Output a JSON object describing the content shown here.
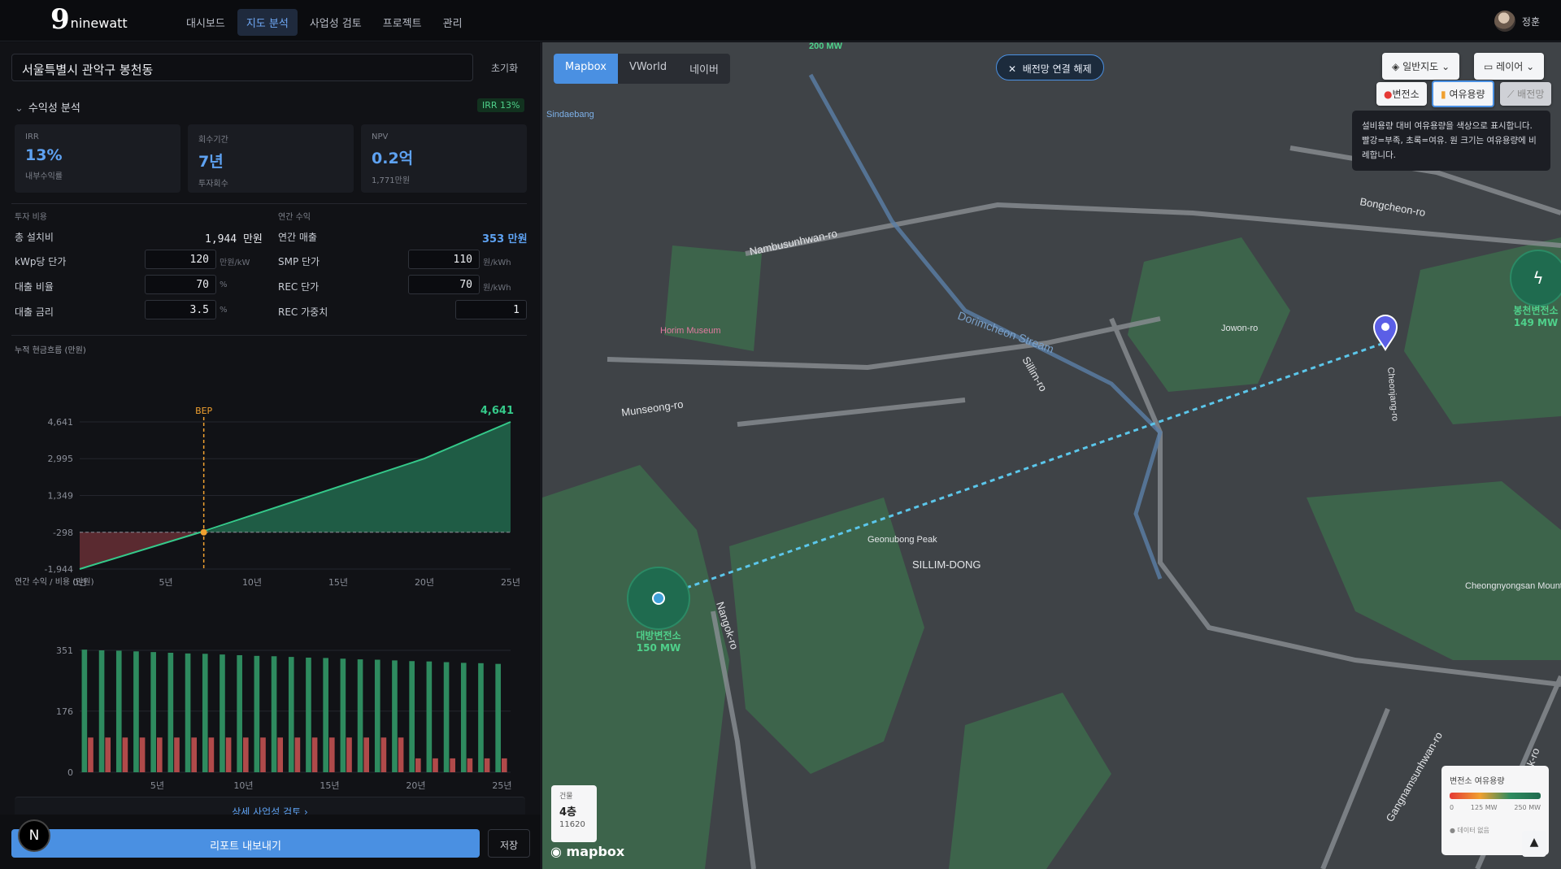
{
  "app": {
    "logo_mark": "9",
    "logo_text": "ninewatt",
    "user_name": "정훈"
  },
  "nav": {
    "items": [
      "대시보드",
      "지도 분석",
      "사업성 검토",
      "프로젝트",
      "관리"
    ],
    "active": "지도 분석"
  },
  "sidebar": {
    "address": "서울특별시 관악구 봉천동",
    "reset_label": "초기화",
    "section_title": "수익성 분석",
    "irr_badge": "IRR 13%",
    "cards": [
      {
        "label": "IRR",
        "value": "13%",
        "sub": "내부수익률"
      },
      {
        "label": "회수기간",
        "value": "7년",
        "sub": "투자회수"
      },
      {
        "label": "NPV",
        "value": "0.2억",
        "sub": "1,771만원"
      }
    ],
    "invest": {
      "title": "투자 비용",
      "total_label": "총 설치비",
      "total_value": "1,944 만원",
      "kw_label": "kWp당 단가",
      "kw_value": "120",
      "kw_unit": "만원/kW",
      "loan_ratio_label": "대출 비율",
      "loan_ratio_value": "70",
      "loan_ratio_unit": "%",
      "rate_label": "대출 금리",
      "rate_value": "3.5",
      "rate_unit": "%"
    },
    "revenue": {
      "title": "연간 수익",
      "sales_label": "연간 매출",
      "sales_value": "353 만원",
      "smp_label": "SMP 단가",
      "smp_value": "110",
      "smp_unit": "원/kWh",
      "rec_label": "REC 단가",
      "rec_value": "70",
      "rec_unit": "원/kWh",
      "weight_label": "REC 가중치",
      "weight_value": "1"
    },
    "cum_chart_title": "누적 현금흐름 (만원)",
    "annual_chart_title": "연간 수익 / 비용 (만원)",
    "detail_button": "상세 사업성 검토 ›",
    "export_button": "리포트 내보내기",
    "save_button": "저장",
    "n_button": "N"
  },
  "chart_data": [
    {
      "type": "area",
      "title": "누적 현금흐름 (만원)",
      "x": [
        0,
        7,
        20,
        25
      ],
      "y": [
        -1944,
        -298,
        3000,
        4641
      ],
      "yticks": [
        "4,641",
        "2,995",
        "1,349",
        "-298",
        "-1,944"
      ],
      "ytick_values": [
        4641,
        2995,
        1349,
        -298,
        -1944
      ],
      "xticks": [
        "0년",
        "5년",
        "10년",
        "15년",
        "20년",
        "25년"
      ],
      "xtick_values": [
        0,
        5,
        10,
        15,
        20,
        25
      ],
      "ylim": [
        -1944,
        4641
      ],
      "bep_label": "BEP",
      "bep_x": 7.2,
      "end_label": "4,641",
      "colors": {
        "line": "#35c98a",
        "positive": "#1f5c45",
        "negative": "#5a2a30",
        "bep": "#f0a030"
      }
    },
    {
      "type": "bar",
      "title": "연간 수익 / 비용 (만원)",
      "categories": [
        1,
        2,
        3,
        4,
        5,
        6,
        7,
        8,
        9,
        10,
        11,
        12,
        13,
        14,
        15,
        16,
        17,
        18,
        19,
        20,
        21,
        22,
        23,
        24,
        25
      ],
      "series": [
        {
          "name": "매출",
          "color": "#2e8b5f",
          "values": [
            353,
            351,
            350,
            348,
            346,
            344,
            342,
            341,
            339,
            337,
            335,
            334,
            332,
            330,
            329,
            327,
            325,
            324,
            322,
            320,
            319,
            317,
            315,
            314,
            312
          ]
        },
        {
          "name": "유지비+이자",
          "color": "#b04a4a",
          "values": [
            100,
            100,
            100,
            100,
            100,
            100,
            100,
            100,
            100,
            100,
            100,
            100,
            100,
            100,
            100,
            100,
            100,
            100,
            100,
            40,
            40,
            40,
            40,
            40,
            40
          ]
        }
      ],
      "yticks": [
        "351",
        "176",
        "0"
      ],
      "ytick_values": [
        351,
        176,
        0
      ],
      "xticks": [
        "5년",
        "10년",
        "15년",
        "20년",
        "25년"
      ],
      "xtick_values": [
        5,
        10,
        15,
        20,
        25
      ],
      "ylim": [
        0,
        351
      ]
    }
  ],
  "map": {
    "tabs": [
      "Mapbox",
      "VWorld",
      "네이버"
    ],
    "active_tab": "Mapbox",
    "disconnect_label": "배전망 연결 해제",
    "basemap_label": "일반지도",
    "layer_label": "레이어",
    "chip_substation": "변전소",
    "chip_capacity": "여유용량",
    "chip_grid": "배전망",
    "tooltip": "설비용량 대비 여유용량을 색상으로 표시합니다. 빨강=부족, 초록=여유. 원 크기는 여유용량에 비례합니다.",
    "legend_title": "변전소 여유용량",
    "legend_ticks": [
      "0",
      "125 MW",
      "250 MW"
    ],
    "legend_no_data": "데이터 없음",
    "substation_a": {
      "name": "대방변전소",
      "capacity": "150 MW"
    },
    "substation_b": {
      "name": "봉천변전소",
      "capacity": "149 MW"
    },
    "top_label": "200 MW",
    "building": {
      "label": "건물",
      "floors": "4층",
      "code": "11620"
    },
    "attribution": "mapbox",
    "places": {
      "sindaebang": "Sindaebang",
      "namb": "Nambusunhwan-ro",
      "munseong": "Munseong-ro",
      "nangok": "Nangok-ro",
      "sillim": "Sillim-ro",
      "silliml": "SILLIM-DONG",
      "geonubong": "Geonubong Peak",
      "gwanak": "Gwanak-ro",
      "cheongnyong": "Cheongnyongsan Mountain",
      "horim": "Horim Museum",
      "dorimcheon": "Dorimcheon Stream",
      "bongcheon": "Bongcheon-ro",
      "gangnam": "Gangnamsunhwan-ro",
      "jowon": "Jowon-ro",
      "cheonjang": "Cheonjang-ro"
    }
  }
}
